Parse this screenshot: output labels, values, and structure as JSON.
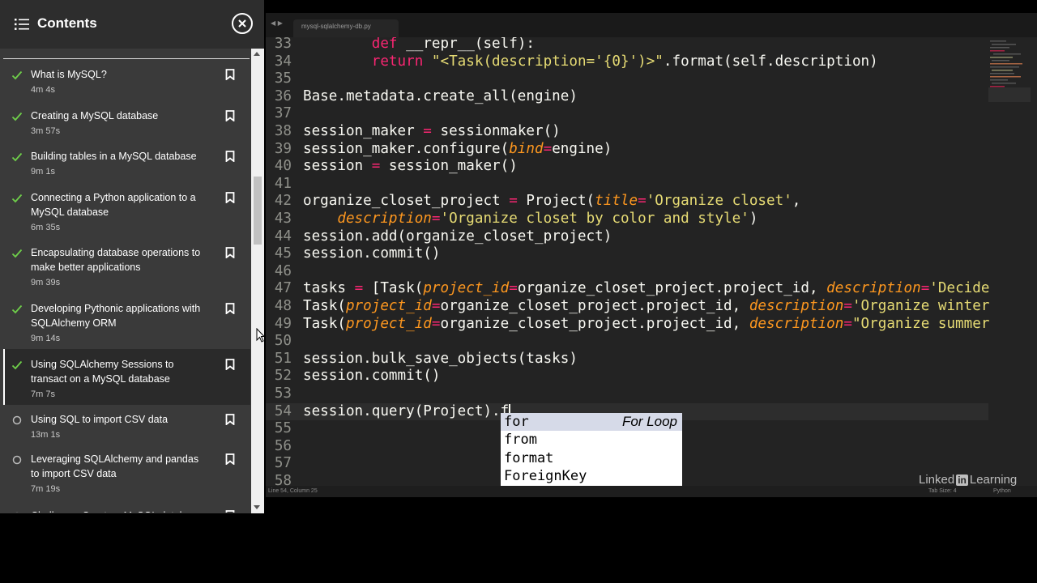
{
  "sidebar": {
    "title": "Contents",
    "items": [
      {
        "title": "What is MySQL?",
        "duration": "4m 4s",
        "completed": true,
        "active": false
      },
      {
        "title": "Creating a MySQL database",
        "duration": "3m 57s",
        "completed": true,
        "active": false
      },
      {
        "title": "Building tables in a MySQL database",
        "duration": "9m 1s",
        "completed": true,
        "active": false
      },
      {
        "title": "Connecting a Python application to a MySQL database",
        "duration": "6m 35s",
        "completed": true,
        "active": false
      },
      {
        "title": "Encapsulating database operations to make better applications",
        "duration": "9m 39s",
        "completed": true,
        "active": false
      },
      {
        "title": "Developing Pythonic applications with SQLAlchemy ORM",
        "duration": "9m 14s",
        "completed": true,
        "active": false
      },
      {
        "title": "Using SQLAlchemy Sessions to transact on a MySQL database",
        "duration": "7m 7s",
        "completed": true,
        "active": true
      },
      {
        "title": "Using SQL to import CSV data",
        "duration": "13m 1s",
        "completed": false,
        "active": false
      },
      {
        "title": "Leveraging SQLAlchemy and pandas to import CSV data",
        "duration": "7m 19s",
        "completed": false,
        "active": false
      },
      {
        "title": "Challenge: Create a MySQL database",
        "duration": "",
        "completed": false,
        "active": false
      }
    ]
  },
  "editor": {
    "tab_title": "mysql-sqlalchemy-db.py",
    "lines": [
      {
        "n": "33",
        "segs": [
          [
            "p",
            "        "
          ],
          [
            "kw",
            "def"
          ],
          [
            "p",
            " __repr__(self):"
          ]
        ]
      },
      {
        "n": "34",
        "segs": [
          [
            "p",
            "        "
          ],
          [
            "kw",
            "return"
          ],
          [
            "p",
            " "
          ],
          [
            "str",
            "\"<Task(description='{0}')>\""
          ],
          [
            "p",
            ".format(self.description)"
          ]
        ]
      },
      {
        "n": "35",
        "segs": []
      },
      {
        "n": "36",
        "segs": [
          [
            "p",
            "Base.metadata.create_all(engine)"
          ]
        ]
      },
      {
        "n": "37",
        "segs": []
      },
      {
        "n": "38",
        "segs": [
          [
            "p",
            "session_maker "
          ],
          [
            "op",
            "="
          ],
          [
            "p",
            " sessionmaker()"
          ]
        ]
      },
      {
        "n": "39",
        "segs": [
          [
            "p",
            "session_maker.configure("
          ],
          [
            "arg",
            "bind"
          ],
          [
            "op",
            "="
          ],
          [
            "p",
            "engine)"
          ]
        ]
      },
      {
        "n": "40",
        "segs": [
          [
            "p",
            "session "
          ],
          [
            "op",
            "="
          ],
          [
            "p",
            " session_maker()"
          ]
        ]
      },
      {
        "n": "41",
        "segs": []
      },
      {
        "n": "42",
        "segs": [
          [
            "p",
            "organize_closet_project "
          ],
          [
            "op",
            "="
          ],
          [
            "p",
            " Project("
          ],
          [
            "arg",
            "title"
          ],
          [
            "op",
            "="
          ],
          [
            "str",
            "'Organize closet'"
          ],
          [
            "p",
            ","
          ]
        ]
      },
      {
        "n": "43",
        "segs": [
          [
            "p",
            "    "
          ],
          [
            "arg",
            "description"
          ],
          [
            "op",
            "="
          ],
          [
            "str",
            "'Organize closet by color and style'"
          ],
          [
            "p",
            ")"
          ]
        ]
      },
      {
        "n": "44",
        "segs": [
          [
            "p",
            "session.add(organize_closet_project)"
          ]
        ]
      },
      {
        "n": "45",
        "segs": [
          [
            "p",
            "session.commit()"
          ]
        ]
      },
      {
        "n": "46",
        "segs": []
      },
      {
        "n": "47",
        "segs": [
          [
            "p",
            "tasks "
          ],
          [
            "op",
            "="
          ],
          [
            "p",
            " [Task("
          ],
          [
            "arg",
            "project_id"
          ],
          [
            "op",
            "="
          ],
          [
            "p",
            "organize_closet_project.project_id, "
          ],
          [
            "arg",
            "description"
          ],
          [
            "op",
            "="
          ],
          [
            "str",
            "'Decide what clothes to donate'"
          ]
        ]
      },
      {
        "n": "48",
        "segs": [
          [
            "p",
            "Task("
          ],
          [
            "arg",
            "project_id"
          ],
          [
            "op",
            "="
          ],
          [
            "p",
            "organize_closet_project.project_id, "
          ],
          [
            "arg",
            "description"
          ],
          [
            "op",
            "="
          ],
          [
            "str",
            "'Organize winter clothes'"
          ]
        ]
      },
      {
        "n": "49",
        "segs": [
          [
            "p",
            "Task("
          ],
          [
            "arg",
            "project_id"
          ],
          [
            "op",
            "="
          ],
          [
            "p",
            "organize_closet_project.project_id, "
          ],
          [
            "arg",
            "description"
          ],
          [
            "op",
            "="
          ],
          [
            "str",
            "\"Organize summer clothes\""
          ]
        ]
      },
      {
        "n": "50",
        "segs": []
      },
      {
        "n": "51",
        "segs": [
          [
            "p",
            "session.bulk_save_objects(tasks)"
          ]
        ]
      },
      {
        "n": "52",
        "segs": [
          [
            "p",
            "session.commit()"
          ]
        ]
      },
      {
        "n": "53",
        "segs": []
      },
      {
        "n": "54",
        "segs": [
          [
            "p",
            "session.query(Project).f"
          ]
        ],
        "current": true
      },
      {
        "n": "55",
        "segs": []
      },
      {
        "n": "56",
        "segs": []
      },
      {
        "n": "57",
        "segs": []
      },
      {
        "n": "58",
        "segs": []
      }
    ],
    "autocomplete": [
      {
        "label": "for",
        "hint": "For Loop",
        "selected": true
      },
      {
        "label": "from",
        "hint": "",
        "selected": false
      },
      {
        "label": "format",
        "hint": "",
        "selected": false
      },
      {
        "label": "ForeignKey",
        "hint": "",
        "selected": false
      }
    ],
    "watermark_left": "Linked",
    "watermark_in": "in",
    "watermark_right": "Learning",
    "status_left": "Line 54, Column 25",
    "status_tab_size": "Tab Size: 4",
    "status_language": "Python"
  },
  "colors": {
    "keyword": "#f92672",
    "string": "#e6db74",
    "argument": "#fd971f",
    "completed_check": "#6fcf4a"
  }
}
